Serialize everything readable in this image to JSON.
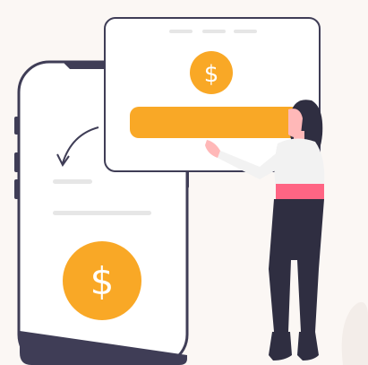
{
  "illustration": {
    "currency_symbol_card": "$",
    "currency_symbol_phone": "$"
  },
  "colors": {
    "background": "#fbf7f4",
    "outline": "#3f3d56",
    "accent": "#f9a826",
    "placeholder": "#e6e6e6",
    "shirt": "#f2f2f2",
    "skin": "#ffb8b8",
    "waist": "#ff6584",
    "pants": "#2f2e41"
  }
}
